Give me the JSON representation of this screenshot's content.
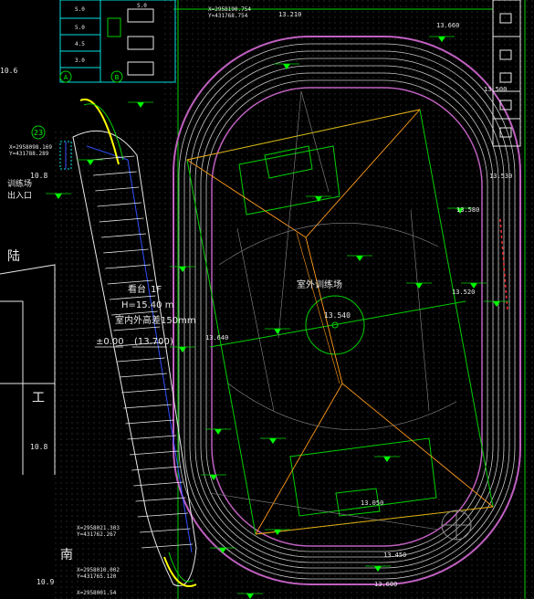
{
  "colors": {
    "background": "#000000",
    "track": "#c8c8c8",
    "track_outer": "#c060c0",
    "field_line": "#00d000",
    "orange_grid": "#ff9a1a",
    "blue": "#3050ff",
    "yellow": "#ffff00",
    "cyan": "#00e0e0",
    "white_text": "#e8e8e8",
    "green_text": "#00ff00"
  },
  "labels": {
    "field_name": "室外训练场",
    "grandstand_name": "看台",
    "grandstand_storey": "1F",
    "grandstand_height": "H=15.40 m",
    "grandstand_outdoor_elev": "室内外高差150mm",
    "grandstand_floor_elev": "±0.00",
    "grandstand_abs_elev": "(13.700)",
    "west_entrance_line1": "训练场",
    "west_entrance_line2": "出入口",
    "char_lu": "陆",
    "char_gong": "工",
    "char_nan": "南",
    "center_elev": "13.540",
    "elev_10_8a": "10.8",
    "elev_10_8b": "10.8",
    "elev_10_9": "10.9",
    "elev_10_6": "10.6",
    "pt_a": "13.210",
    "pt_b": "13.660",
    "pt_c": "13.530",
    "pt_d": "13.580",
    "pt_e": "13.520",
    "pt_f": "13.640",
    "pt_g": "13.050",
    "pt_h": "13.450",
    "pt_i": "13.500",
    "pt_j": "13.600",
    "coord_top_1": "X=2958190.754",
    "coord_top_2": "Y=431768.754",
    "coord_left_1": "X=2958098.169",
    "coord_left_2": "Y=431788.289",
    "coord_bottom_1": "X=2958021.303",
    "coord_bottom_2": "Y=431762.267",
    "coord_bottom_3": "X=2958010.002",
    "coord_bottom_4": "Y=431765.120",
    "coord_bottom_5": "X=2958001.54",
    "table_h1": "S.0",
    "table_h2": "S.0",
    "table_r1": "5.0",
    "table_r2": "4.5",
    "table_r3": "3.0",
    "circle_23": "23",
    "circle_a": "A",
    "circle_b": "B"
  }
}
